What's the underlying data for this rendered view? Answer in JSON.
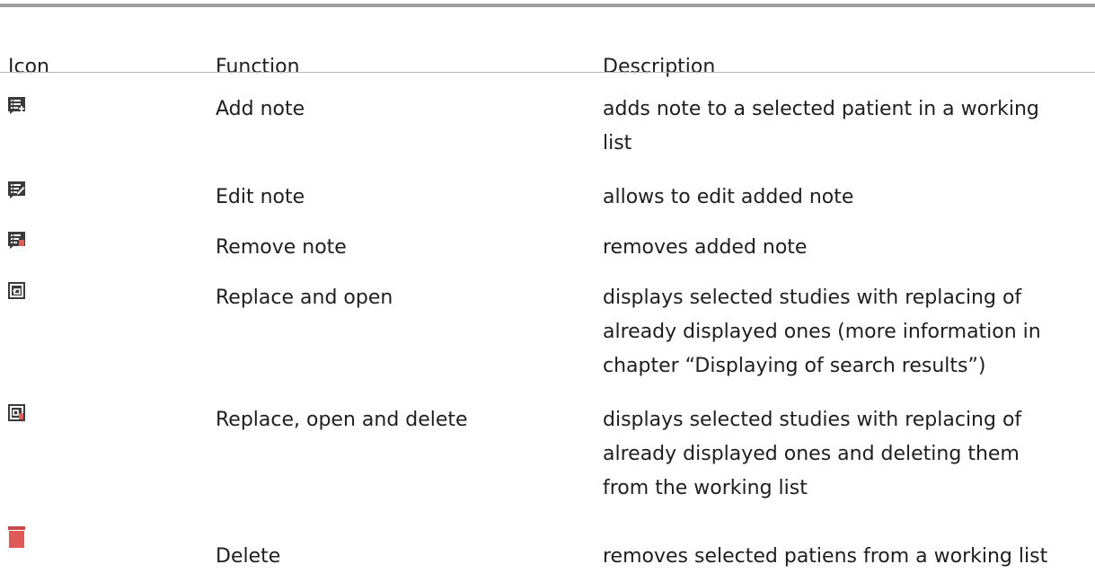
{
  "table": {
    "headers": {
      "icon": "Icon",
      "function": "Function",
      "description": "Description"
    },
    "rows": [
      {
        "icon": "add-note-icon",
        "function": "Add note",
        "description_lines": [
          "adds note to a selected patient in a working",
          "list"
        ]
      },
      {
        "icon": "edit-note-icon",
        "function": "Edit note",
        "description_lines": [
          "allows to edit added note"
        ]
      },
      {
        "icon": "remove-note-icon",
        "function": "Remove note",
        "description_lines": [
          "removes added note"
        ]
      },
      {
        "icon": "replace-open-icon",
        "function": "Replace and open",
        "description_lines": [
          "displays selected studies with replacing of",
          "already displayed ones (more information in",
          "chapter “Displaying of search results”)"
        ]
      },
      {
        "icon": "replace-open-delete-icon",
        "function": "Replace, open and delete",
        "description_lines": [
          "displays selected studies with replacing of",
          "already displayed ones and deleting them",
          "from the working list"
        ]
      },
      {
        "icon": "trash-icon",
        "function": "Delete",
        "description_lines": [
          "removes selected patiens from a working list"
        ]
      }
    ]
  },
  "colors": {
    "icon_dark": "#3b3b3b",
    "icon_red": "#e05a5a",
    "text": "#1e1e1e",
    "rule": "#9d9d9d"
  }
}
